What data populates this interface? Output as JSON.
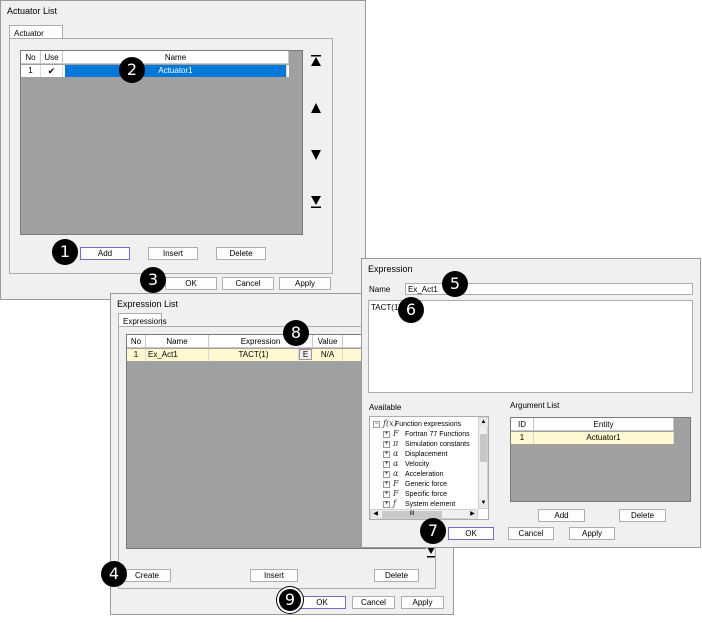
{
  "actuator_list": {
    "title": "Actuator List",
    "tab": "Actuator List",
    "columns": [
      "No",
      "Use",
      "Name"
    ],
    "rows": [
      {
        "no": "1",
        "use": "✔",
        "name": "Actuator1"
      }
    ],
    "buttons": {
      "add": "Add",
      "insert": "Insert",
      "delete": "Delete",
      "ok": "OK",
      "cancel": "Cancel",
      "apply": "Apply"
    },
    "order_icons": [
      "move-top-icon",
      "move-up-icon",
      "move-down-icon",
      "move-bottom-icon"
    ]
  },
  "expression_list": {
    "title": "Expression List",
    "tab": "Expressions",
    "columns": [
      "No",
      "Name",
      "Expression",
      "Value"
    ],
    "rows": [
      {
        "no": "1",
        "name": "Ex_Act1",
        "expression": "TACT(1)",
        "edit": "E",
        "value": "N/A"
      }
    ],
    "buttons": {
      "create": "Create",
      "insert": "Insert",
      "delete": "Delete",
      "ok": "OK",
      "cancel": "Cancel",
      "apply": "Apply"
    }
  },
  "expression": {
    "title": "Expression",
    "name_label": "Name",
    "name_value": "Ex_Act1",
    "body": "TACT(1)",
    "available_label": "Available",
    "tree": [
      {
        "label": "Function expressions",
        "icon": "ƒ(x)"
      },
      {
        "label": "Fortran 77 Functions",
        "icon": "F"
      },
      {
        "label": "Simulation constants",
        "icon": "π"
      },
      {
        "label": "Displacement",
        "icon": "α"
      },
      {
        "label": "Velocity",
        "icon": "α"
      },
      {
        "label": "Acceleration",
        "icon": "α"
      },
      {
        "label": "Generic force",
        "icon": "F"
      },
      {
        "label": "Specific force",
        "icon": "F"
      },
      {
        "label": "System element",
        "icon": "ƒ"
      }
    ],
    "argument_label": "Argument List",
    "arg_columns": [
      "ID",
      "Entity"
    ],
    "arg_rows": [
      {
        "id": "1",
        "entity": "Actuator1"
      }
    ],
    "buttons": {
      "add": "Add",
      "delete": "Delete",
      "ok": "OK",
      "cancel": "Cancel",
      "apply": "Apply"
    },
    "scroll_mid": "III"
  },
  "callouts": [
    "1",
    "2",
    "3",
    "4",
    "5",
    "6",
    "7",
    "8",
    "9"
  ],
  "colors": {
    "selected_row": "#0078d7",
    "highlight_row": "#fff8d0",
    "grid_bg": "#a0a0a0",
    "dialog_bg": "#f0f0f0",
    "focus_border": "#7b68c8"
  }
}
